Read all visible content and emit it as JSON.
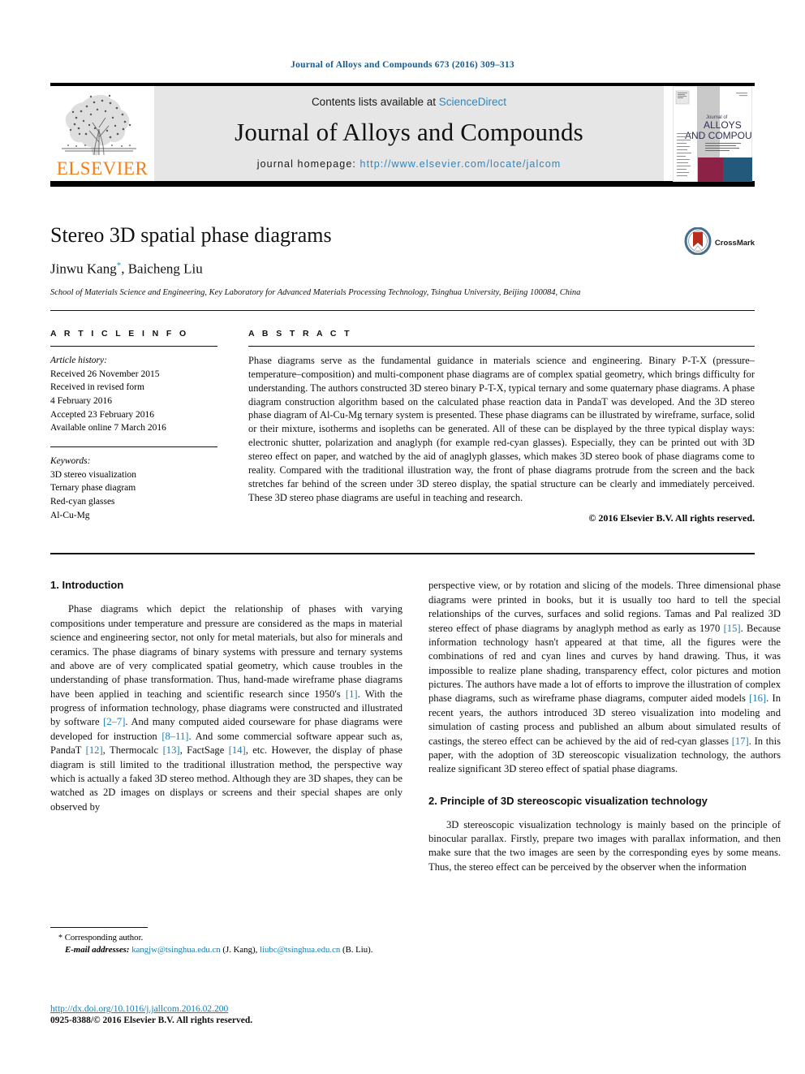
{
  "running_head": "Journal of Alloys and Compounds 673 (2016) 309–313",
  "masthead": {
    "publisher": "ELSEVIER",
    "contents_prefix": "Contents lists available at ",
    "contents_link": "ScienceDirect",
    "journal_title": "Journal of Alloys and Compounds",
    "homepage_label": "journal homepage: ",
    "homepage_url": "http://www.elsevier.com/locate/jalcom",
    "cover": {
      "line1": "Journal of",
      "line2": "ALLOYS",
      "line3": "AND COMPOUNDS"
    }
  },
  "article": {
    "title": "Stereo 3D spatial phase diagrams",
    "authors": "Jinwu Kang",
    "authors_marker": "*",
    "authors_rest": ", Baicheng Liu",
    "affiliation": "School of Materials Science and Engineering, Key Laboratory for Advanced Materials Processing Technology, Tsinghua University, Beijing 100084, China",
    "crossmark_label": "CrossMark"
  },
  "article_info": {
    "heading": "A R T I C L E   I N F O",
    "history_label": "Article history:",
    "history": [
      "Received 26 November 2015",
      "Received in revised form",
      "4 February 2016",
      "Accepted 23 February 2016",
      "Available online 7 March 2016"
    ],
    "keywords_label": "Keywords:",
    "keywords": [
      "3D stereo visualization",
      "Ternary phase diagram",
      "Red-cyan glasses",
      "Al-Cu-Mg"
    ]
  },
  "abstract": {
    "heading": "A B S T R A C T",
    "text": "Phase diagrams serve as the fundamental guidance in materials science and engineering. Binary P-T-X (pressure–temperature–composition) and multi-component phase diagrams are of complex spatial geometry, which brings difficulty for understanding. The authors constructed 3D stereo binary P-T-X, typical ternary and some quaternary phase diagrams. A phase diagram construction algorithm based on the calculated phase reaction data in PandaT was developed. And the 3D stereo phase diagram of Al-Cu-Mg ternary system is presented. These phase diagrams can be illustrated by wireframe, surface, solid or their mixture, isotherms and isopleths can be generated. All of these can be displayed by the three typical display ways: electronic shutter, polarization and anaglyph (for example red-cyan glasses). Especially, they can be printed out with 3D stereo effect on paper, and watched by the aid of anaglyph glasses, which makes 3D stereo book of phase diagrams come to reality. Compared with the traditional illustration way, the front of phase diagrams protrude from the screen and the back stretches far behind of the screen under 3D stereo display, the spatial structure can be clearly and immediately perceived. These 3D stereo phase diagrams are useful in teaching and research.",
    "copyright": "© 2016 Elsevier B.V. All rights reserved."
  },
  "sections": {
    "intro_heading": "1.  Introduction",
    "intro_p1_a": "Phase diagrams which depict the relationship of phases with varying compositions under temperature and pressure are considered as the maps in material science and engineering sector, not only for metal materials, but also for minerals and ceramics. The phase diagrams of binary systems with pressure and ternary systems and above are of very complicated spatial geometry, which cause troubles in the understanding of phase transformation. Thus, hand-made wireframe phase diagrams have been applied in teaching and scientific research since 1950's ",
    "ref1": "[1]",
    "intro_p1_b": ". With the progress of information technology, phase diagrams were constructed and illustrated by software ",
    "ref2": "[2–7]",
    "intro_p1_c": ". And many computed aided courseware for phase diagrams were developed for instruction ",
    "ref3": "[8–11]",
    "intro_p1_d": ". And some commercial software appear such as, PandaT ",
    "ref4": "[12]",
    "intro_p1_e": ", Thermocalc ",
    "ref5": "[13]",
    "intro_p1_f": ", FactSage ",
    "ref6": "[14]",
    "intro_p1_g": ", etc. However, the display of phase diagram is still limited to the traditional illustration method, the perspective way which is actually a faked 3D stereo method. Although they are 3D shapes, they can be watched as 2D images on displays or screens and their special shapes are only observed by perspective view, or by rotation and slicing of the models. Three dimensional phase diagrams were printed in books, but it is usually too hard to tell the special relationships of the curves, surfaces and solid regions. Tamas and Pal realized 3D stereo effect of phase diagrams by anaglyph method as early as 1970 ",
    "ref7": "[15]",
    "intro_p1_h": ". Because information technology hasn't appeared at that time, all the figures were the combinations of red and cyan lines and curves by hand drawing. Thus, it was impossible to realize plane shading, transparency effect, color pictures and motion pictures. The authors have made a lot of efforts to improve the illustration of complex phase diagrams, such as wireframe phase diagrams, computer aided models ",
    "ref8": "[16]",
    "intro_p1_i": ". In recent years, the authors introduced 3D stereo visualization into modeling and simulation of casting process and published an album about simulated results of castings, the stereo effect can be achieved by the aid of red-cyan glasses ",
    "ref9": "[17]",
    "intro_p1_j": ". In this paper, with the adoption of 3D stereoscopic visualization technology, the authors realize significant 3D stereo effect of spatial phase diagrams.",
    "principle_heading": "2.  Principle of 3D stereoscopic visualization technology",
    "principle_p1": "3D stereoscopic visualization technology is mainly based on the principle of binocular parallax. Firstly, prepare two images with parallax information, and then make sure that the two images are seen by the corresponding eyes by some means. Thus, the stereo effect can be perceived by the observer when the information"
  },
  "footnote": {
    "star": "*",
    "corresponding": "Corresponding author.",
    "email_label": "E-mail addresses:",
    "email1": "kangjw@tsinghua.edu.cn",
    "email1_who": "(J. Kang),",
    "email2": "liubc@tsinghua.edu.cn",
    "email2_who": "(B. Liu)."
  },
  "footer": {
    "doi": "http://dx.doi.org/10.1016/j.jallcom.2016.02.200",
    "issn": "0925-8388/© 2016 Elsevier B.V. All rights reserved."
  },
  "colors": {
    "link": "#1a7eb0",
    "running_head": "#1a5b8f",
    "elsevier_orange": "#f07f1a",
    "masthead_bg": "#e6e6e6"
  }
}
